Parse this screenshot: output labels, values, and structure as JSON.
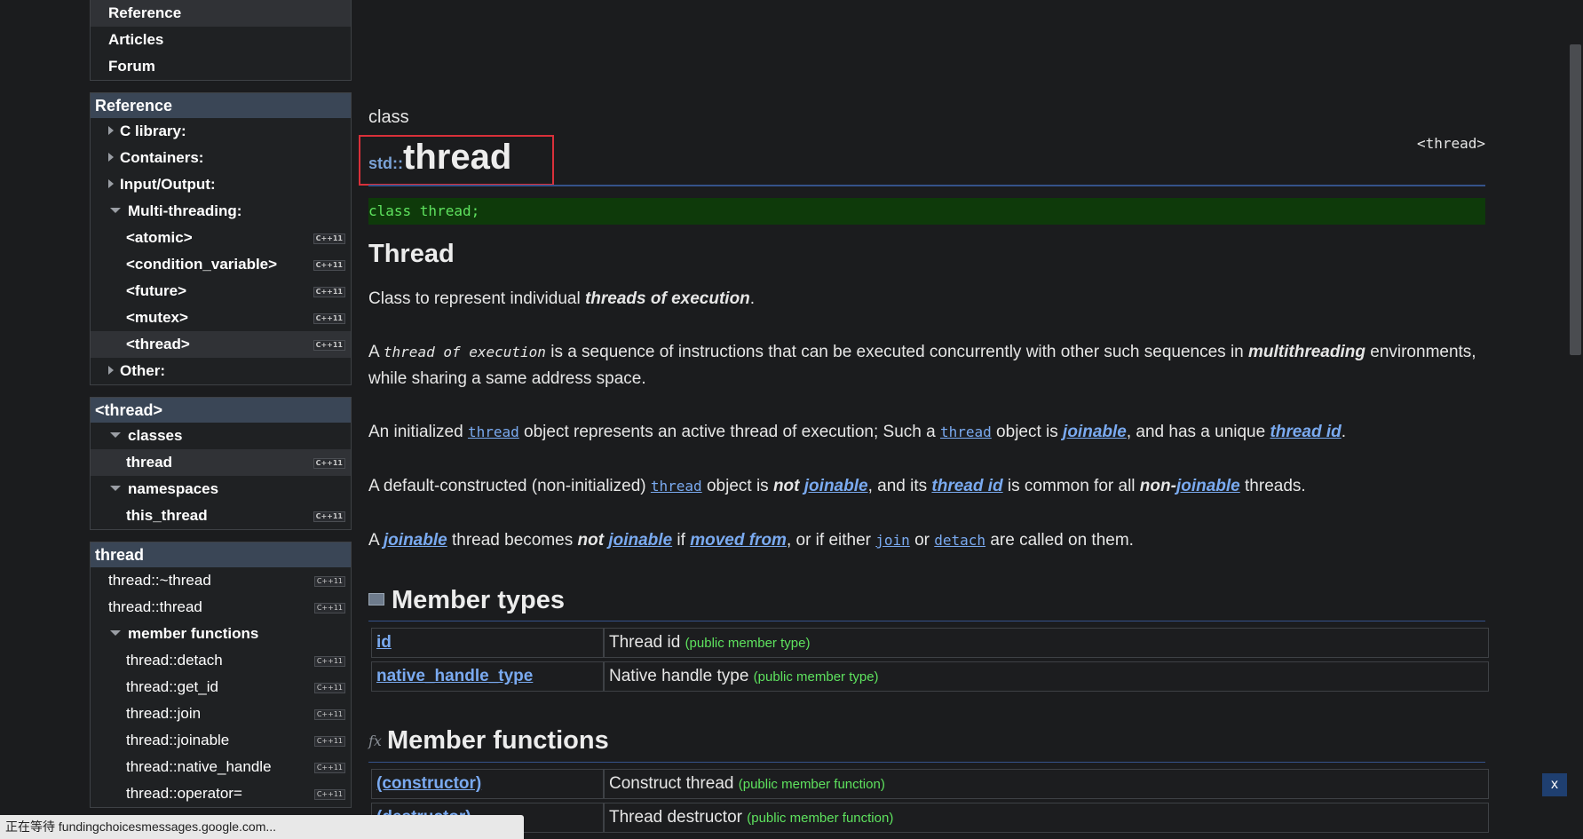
{
  "nav": {
    "items": [
      "Reference",
      "Articles",
      "Forum"
    ]
  },
  "reference_box": {
    "title": "Reference",
    "items": [
      {
        "label": "C library:",
        "tag": ""
      },
      {
        "label": "Containers:",
        "tag": ""
      },
      {
        "label": "Input/Output:",
        "tag": ""
      },
      {
        "label": "Multi-threading:",
        "tag": ""
      },
      {
        "label": "<atomic>",
        "tag": "C++11"
      },
      {
        "label": "<condition_variable>",
        "tag": "C++11"
      },
      {
        "label": "<future>",
        "tag": "C++11"
      },
      {
        "label": "<mutex>",
        "tag": "C++11"
      },
      {
        "label": "<thread>",
        "tag": "C++11"
      },
      {
        "label": "Other:",
        "tag": ""
      }
    ]
  },
  "thread_header_box": {
    "title": "<thread>",
    "items": [
      {
        "label": "classes",
        "tag": ""
      },
      {
        "label": "thread",
        "tag": "C++11"
      },
      {
        "label": "namespaces",
        "tag": ""
      },
      {
        "label": "this_thread",
        "tag": "C++11"
      }
    ]
  },
  "thread_box": {
    "title": "thread",
    "items": [
      {
        "label": "thread::~thread",
        "tag": "C++11"
      },
      {
        "label": "thread::thread",
        "tag": "C++11"
      },
      {
        "label": "member functions",
        "tag": ""
      },
      {
        "label": "thread::detach",
        "tag": "C++11"
      },
      {
        "label": "thread::get_id",
        "tag": "C++11"
      },
      {
        "label": "thread::join",
        "tag": "C++11"
      },
      {
        "label": "thread::joinable",
        "tag": "C++11"
      },
      {
        "label": "thread::native_handle",
        "tag": "C++11"
      },
      {
        "label": "thread::operator=",
        "tag": "C++11"
      }
    ]
  },
  "main": {
    "kind": "class",
    "header_ref": "<thread>",
    "namespace": "std::",
    "name": "thread",
    "declaration": "class thread;",
    "heading": "Thread",
    "p1": {
      "a": "Class to represent individual ",
      "b": "threads of execution",
      "c": "."
    },
    "p2": {
      "a": "A ",
      "b": "thread of execution",
      "c": " is a sequence of instructions that can be executed concurrently with other such sequences in ",
      "d": "multithreading",
      "e": " environments, while sharing a same address space."
    },
    "p3": {
      "a": "An initialized ",
      "b": "thread",
      "c": " object represents an active thread of execution; Such a ",
      "d": "thread",
      "e": " object is ",
      "f": "joinable",
      "g": ", and has a unique ",
      "h": "thread id",
      "i": "."
    },
    "p4": {
      "a": "A default-constructed (non-initialized) ",
      "b": "thread",
      "c": " object is ",
      "d": "not",
      "e": "joinable",
      "f": ", and its ",
      "g": "thread id",
      "h": " is common for all ",
      "i": "non-",
      "j": "joinable",
      "k": " threads."
    },
    "p5": {
      "a": "A ",
      "b": "joinable",
      "c": " thread becomes ",
      "d": "not",
      "e": "joinable",
      "f": " if ",
      "g": "moved from",
      "h": ", or if either ",
      "i": "join",
      "j": " or ",
      "k": "detach",
      "l": " are called on them."
    },
    "member_types_title": "Member types",
    "member_types": [
      {
        "name": "id",
        "desc": "Thread id",
        "note": "(public member type)"
      },
      {
        "name": "native_handle_type",
        "desc": "Native handle type",
        "note": "(public member type)"
      }
    ],
    "member_functions_title": "Member functions",
    "member_functions": [
      {
        "name": "(constructor)",
        "desc": "Construct thread",
        "note": "(public member function)"
      },
      {
        "name": "(destructor)",
        "desc": "Thread destructor",
        "note": "(public member function)"
      }
    ]
  },
  "close_button": "x",
  "status_text": "正在等待 fundingchoicesmessages.google.com..."
}
